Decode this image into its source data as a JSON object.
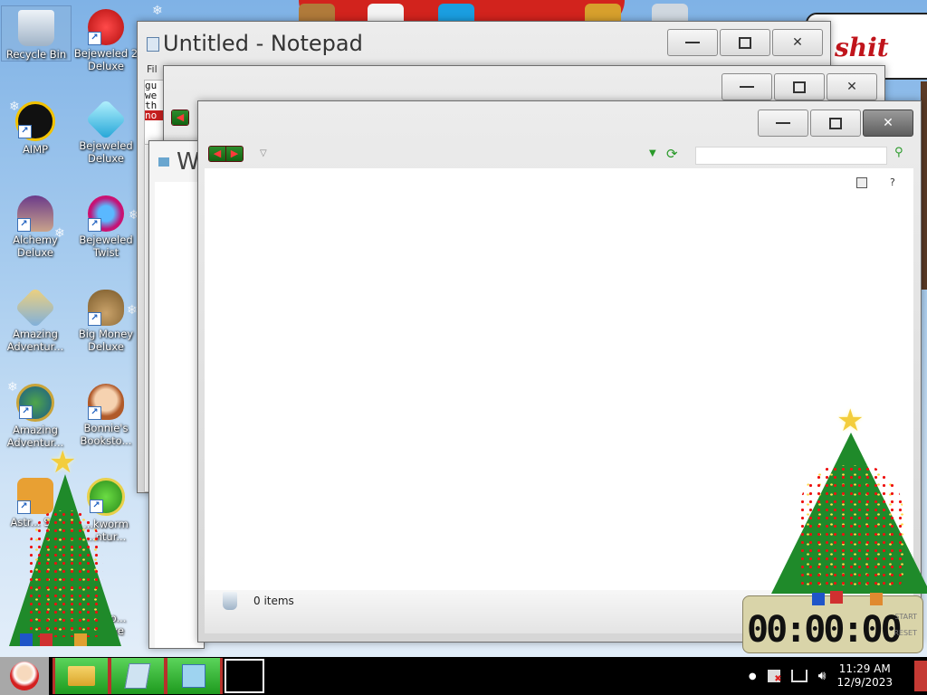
{
  "colors": {
    "accent": "#c0141b",
    "taskbar_bg": "#000000",
    "taskbar_item": "#2eb02e",
    "desktop_bg": "#a9cdef"
  },
  "banner_text": "shit",
  "desktop_icons": [
    {
      "label": "Recycle Bin",
      "icon": "recycle-bin-icon"
    },
    {
      "label": "Bejeweled 2 Deluxe",
      "icon": "bejeweled-2-icon"
    },
    {
      "label": "AIMP",
      "icon": "aimp-icon"
    },
    {
      "label": "Bejeweled Deluxe",
      "icon": "bejeweled-icon"
    },
    {
      "label": "Alchemy Deluxe",
      "icon": "alchemy-icon"
    },
    {
      "label": "Bejeweled Twist",
      "icon": "bejeweled-twist-icon"
    },
    {
      "label": "Amazing Adventur...",
      "icon": "amazing-adventures-icon"
    },
    {
      "label": "Big Money Deluxe",
      "icon": "money-bag-icon"
    },
    {
      "label": "Amazing Adventur...",
      "icon": "amazing-adventures-globe-icon"
    },
    {
      "label": "Bonnie's Booksto...",
      "icon": "bonnie-icon"
    },
    {
      "label": "Astr... S...",
      "icon": "astro-icon"
    },
    {
      "label": "...kworm ...ntur...",
      "icon": "bookworm-icon"
    },
    {
      "label": "...kwo... Deluxe",
      "icon": "bookworm-deluxe-icon"
    }
  ],
  "notepad": {
    "title": "Untitled - Notepad",
    "menu_first": "Fil",
    "text_lines": [
      "gu",
      "we",
      "th",
      "no"
    ]
  },
  "back_window": {
    "title": "W"
  },
  "explorer": {
    "status": "0 items",
    "address_placeholder": "",
    "help": "?"
  },
  "timer": {
    "display": "00:00:00",
    "start": "START",
    "reset": "RESET"
  },
  "tray": {
    "dot": "●",
    "time": "11:29 AM",
    "date": "12/9/2023"
  }
}
